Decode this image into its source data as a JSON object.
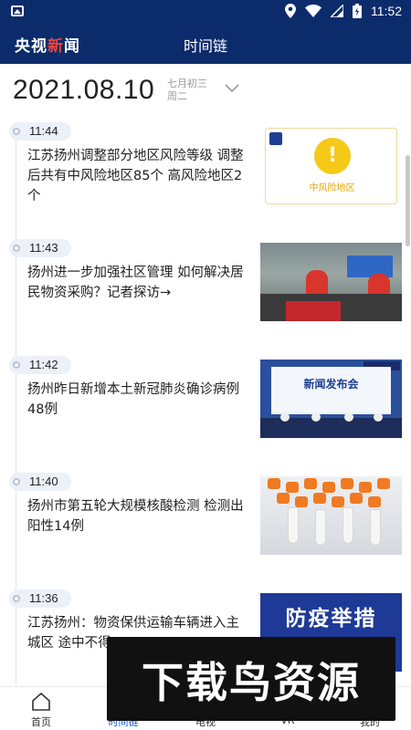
{
  "status_bar": {
    "time": "11:52",
    "icons": [
      "gallery-icon",
      "location-icon",
      "wifi-icon",
      "cellular-icon",
      "battery-icon"
    ]
  },
  "header": {
    "logo_part1": "央视",
    "logo_part2": "新",
    "logo_part3": "闻",
    "title": "时间链",
    "bg_color": "#0b2b6b",
    "logo_accent": "#e8463d"
  },
  "date_bar": {
    "date": "2021.08.10",
    "lunar": "七月初三",
    "weekday": "周二"
  },
  "feed": [
    {
      "time": "11:44",
      "headline": "江苏扬州调整部分地区风险等级 调整后共有中风险地区85个 高风险地区2个",
      "thumb_label": "中风险地区",
      "thumb_mark": "!"
    },
    {
      "time": "11:43",
      "headline": "扬州进一步加强社区管理 如何解决居民物资采购？记者探访→"
    },
    {
      "time": "11:42",
      "headline": "扬州昨日新增本土新冠肺炎确诊病例48例",
      "thumb_text": "新闻发布会"
    },
    {
      "time": "11:40",
      "headline": "扬州市第五轮大规模核酸检测 检测出阳性14例"
    },
    {
      "time": "11:36",
      "headline": "江苏扬州：物资保供运输车辆进入主城区 途中不得",
      "thumb_text": "防疫举措"
    }
  ],
  "tabs": [
    {
      "label": "首页",
      "icon": "home-icon",
      "active": false
    },
    {
      "label": "时间链",
      "icon": "timeline-icon",
      "active": true
    },
    {
      "label": "电视",
      "icon": "tv-icon",
      "active": false
    },
    {
      "label": "VR",
      "icon": "vr-icon",
      "active": false
    },
    {
      "label": "我的",
      "icon": "profile-icon",
      "active": false
    }
  ],
  "watermark": "下载鸟资源"
}
